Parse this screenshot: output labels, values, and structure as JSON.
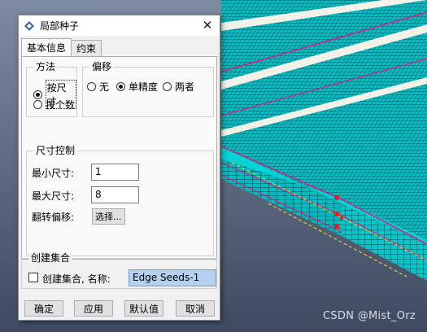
{
  "dialog": {
    "title": "局部种子",
    "close_symbol": "✕",
    "icon": "seed-icon"
  },
  "tabs": [
    {
      "label": "基本信息",
      "active": true
    },
    {
      "label": "约束",
      "active": false
    }
  ],
  "method": {
    "legend": "方法",
    "options": [
      {
        "label": "按尺寸",
        "checked": true
      },
      {
        "label": "按个数",
        "checked": false
      }
    ]
  },
  "bias": {
    "legend": "偏移",
    "options": [
      {
        "label": "无",
        "checked": false
      },
      {
        "label": "单精度",
        "checked": true
      },
      {
        "label": "两者",
        "checked": false
      }
    ]
  },
  "size_control": {
    "legend": "尺寸控制",
    "min_label": "最小尺寸:",
    "min_value": "1",
    "max_label": "最大尺寸:",
    "max_value": "8",
    "flip_label": "翻转偏移:",
    "select_button": "选择..."
  },
  "create_set": {
    "legend": "创建集合",
    "checkbox_label": "创建集合, 名称:",
    "checked": false,
    "name_value": "Edge Seeds-1"
  },
  "buttons": {
    "ok": "确定",
    "apply": "应用",
    "defaults": "默认值",
    "cancel": "取消"
  },
  "watermark": "CSDN @Mist_Orz",
  "colors": {
    "mesh": "#00c8c8",
    "mesh_lines": "#0a2a3a",
    "edge_highlight": "#e0197a",
    "seed_marker": "#e0222a",
    "guide_line": "#f0e030",
    "background": "#5a6880",
    "set_input_bg": "#b5d1ef"
  }
}
